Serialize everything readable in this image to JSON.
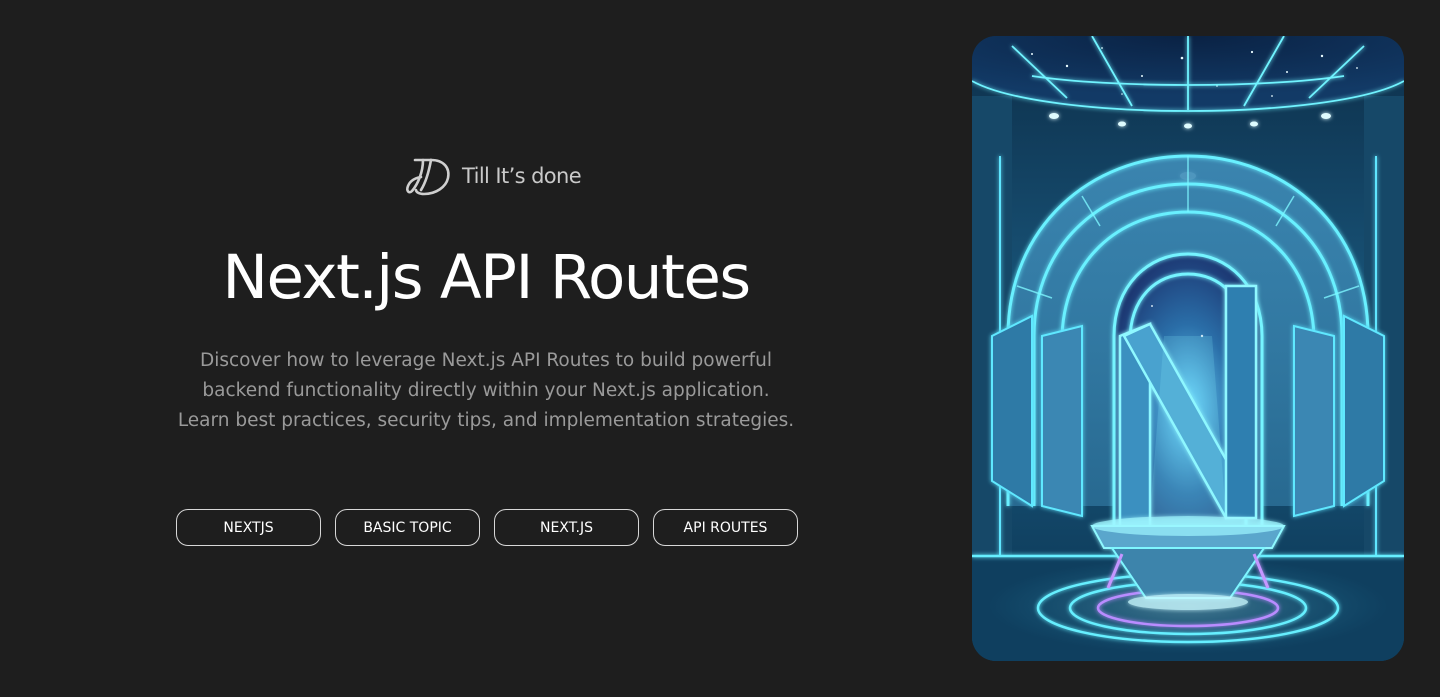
{
  "brand": {
    "logo_icon": "td-monogram-icon",
    "name": "Till It’s done"
  },
  "hero": {
    "title": "Next.js API Routes",
    "description_lines": [
      "Discover how to leverage Next.js API Routes to build powerful",
      "backend functionality directly within your Next.js application.",
      "Learn best practices, security tips, and implementation strategies."
    ]
  },
  "tags": [
    {
      "label": "NEXTJS"
    },
    {
      "label": "BASIC TOPIC"
    },
    {
      "label": "NEXT.JS"
    },
    {
      "label": "API ROUTES"
    }
  ],
  "image": {
    "subject": "futuristic-neon-n-portal-illustration"
  },
  "colors": {
    "background": "#1e1e1e",
    "text_primary": "#ffffff",
    "text_secondary": "#9a9a9a",
    "tag_border": "#d8d8d8",
    "neon_cyan": "#4ff3ff",
    "neon_purple": "#b68cff"
  }
}
